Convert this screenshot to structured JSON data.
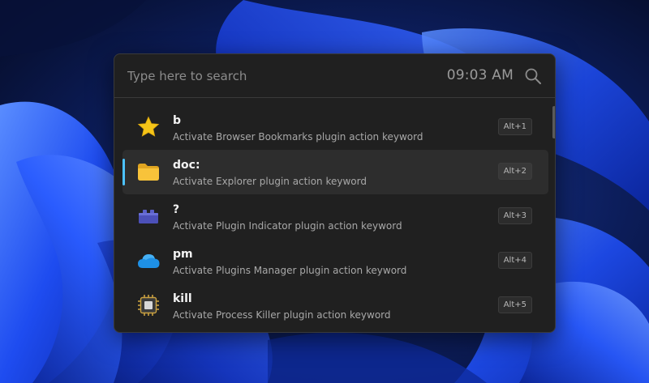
{
  "search": {
    "placeholder": "Type here to search",
    "value": "",
    "clock": "09:03 AM"
  },
  "results": [
    {
      "icon": "star-icon",
      "title": "b",
      "subtitle": "Activate Browser Bookmarks plugin action keyword",
      "hotkey": "Alt+1",
      "selected": false
    },
    {
      "icon": "folder-icon",
      "title": "doc:",
      "subtitle": "Activate Explorer plugin action keyword",
      "hotkey": "Alt+2",
      "selected": true
    },
    {
      "icon": "plugin-brick-icon",
      "title": "?",
      "subtitle": "Activate Plugin Indicator plugin action keyword",
      "hotkey": "Alt+3",
      "selected": false
    },
    {
      "icon": "cloud-icon",
      "title": "pm",
      "subtitle": "Activate Plugins Manager plugin action keyword",
      "hotkey": "Alt+4",
      "selected": false
    },
    {
      "icon": "chip-icon",
      "title": "kill",
      "subtitle": "Activate Process Killer plugin action keyword",
      "hotkey": "Alt+5",
      "selected": false
    }
  ],
  "colors": {
    "accent": "#4cc2ff",
    "window_bg": "#202020",
    "selected_row_bg": "#2d2d2d",
    "wallpaper_blue": "#1f4fff"
  }
}
